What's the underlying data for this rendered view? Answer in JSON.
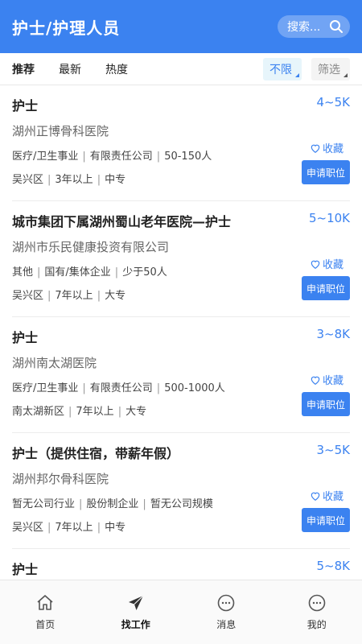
{
  "header": {
    "title": "护士/护理人员",
    "search_placeholder": "搜索...",
    "accent": "#3b82f0"
  },
  "filters": {
    "tabs": [
      {
        "label": "推荐",
        "active": true
      },
      {
        "label": "最新"
      },
      {
        "label": "热度"
      }
    ],
    "dropdown_active": "不限",
    "dropdown_filter": "筛选"
  },
  "jobs": [
    {
      "title": "护士",
      "salary": "4~5K",
      "company": "湖州正博骨科医院",
      "tags": [
        "医疗/卫生事业",
        "有限责任公司",
        "50-150人"
      ],
      "location": [
        "吴兴区",
        "3年以上",
        "中专"
      ],
      "fav_label": "收藏",
      "apply_label": "申请职位"
    },
    {
      "title": "城市集团下属湖州蜀山老年医院—护士",
      "salary": "5~10K",
      "company": "湖州市乐民健康投资有限公司",
      "tags": [
        "其他",
        "国有/集体企业",
        "少于50人"
      ],
      "location": [
        "吴兴区",
        "7年以上",
        "大专"
      ],
      "fav_label": "收藏",
      "apply_label": "申请职位"
    },
    {
      "title": "护士",
      "salary": "3~8K",
      "company": "湖州南太湖医院",
      "tags": [
        "医疗/卫生事业",
        "有限责任公司",
        "500-1000人"
      ],
      "location": [
        "南太湖新区",
        "7年以上",
        "大专"
      ],
      "fav_label": "收藏",
      "apply_label": "申请职位"
    },
    {
      "title": "护士（提供住宿，带薪年假）",
      "salary": "3~5K",
      "company": "湖州邦尔骨科医院",
      "tags": [
        "暂无公司行业",
        "股份制企业",
        "暂无公司规模"
      ],
      "location": [
        "吴兴区",
        "7年以上",
        "中专"
      ],
      "fav_label": "收藏",
      "apply_label": "申请职位"
    },
    {
      "title": "护士",
      "salary": "5~8K"
    }
  ],
  "tabbar": [
    {
      "label": "首页",
      "icon": "home-icon"
    },
    {
      "label": "找工作",
      "icon": "paper-plane-icon",
      "active": true
    },
    {
      "label": "消息",
      "icon": "message-icon"
    },
    {
      "label": "我的",
      "icon": "profile-icon"
    }
  ]
}
